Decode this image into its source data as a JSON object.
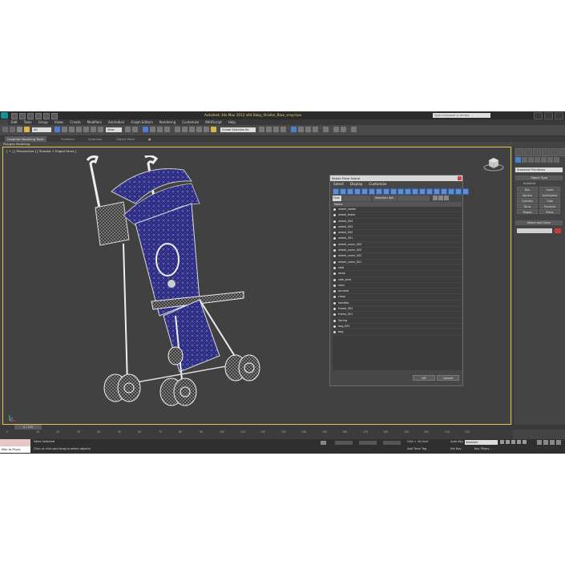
{
  "window": {
    "title": "Autodesk 3ds Max 2012 x64    Baby_Stroller_Blue_vray.max",
    "search_placeholder": "Type a keyword or phrase"
  },
  "menu": [
    "Edit",
    "Tools",
    "Group",
    "Views",
    "Create",
    "Modifiers",
    "Animation",
    "Graph Editors",
    "Rendering",
    "Customize",
    "MAXScript",
    "Help"
  ],
  "toolbar": {
    "selection_filter": "All",
    "ref_coord": "View",
    "named_selection": "Create Selection Se"
  },
  "ribbon": {
    "tabs": [
      "Graphite Modeling Tools",
      "Freeform",
      "Selection",
      "Object Paint"
    ],
    "subtitle": "Polygon Modeling"
  },
  "viewport": {
    "label": "[ + ] [ Perspective ] [ Shaded + Edged Faces ]"
  },
  "command_panel": {
    "category": "Standard Primitives",
    "object_type_header": "Object Type",
    "autogrid": "AutoGrid",
    "buttons": [
      "Box",
      "Cone",
      "Sphere",
      "GeoSphere",
      "Cylinder",
      "Tube",
      "Torus",
      "Pyramid",
      "Teapot",
      "Plane"
    ],
    "name_color_header": "Name and Color"
  },
  "dialog": {
    "title": "Select From Scene",
    "menus": [
      "Select",
      "Display",
      "Customize"
    ],
    "find_label": "Find:",
    "selection_set": "Selection Set:",
    "column_header": "Name",
    "items": [
      "wheel_holder",
      "wheel_brake",
      "wheel_004",
      "wheel_003",
      "wheel_002",
      "wheel_001",
      "wheel_cover_004",
      "wheel_cover_003",
      "wheel_cover_002",
      "wheel_cover_001",
      "seat",
      "strap",
      "side_seat",
      "rood",
      "armrest",
      "clasp",
      "handles",
      "frame_002",
      "frame_001",
      "Spring",
      "bag_001",
      "bag"
    ],
    "ok": "OK",
    "cancel": "Cancel"
  },
  "timeline": {
    "slider": "0 / 225",
    "ticks": [
      "0",
      "10",
      "20",
      "30",
      "40",
      "50",
      "60",
      "70",
      "80",
      "90",
      "100",
      "110",
      "120",
      "130",
      "140",
      "150",
      "160",
      "170",
      "180",
      "190",
      "200",
      "210",
      "220"
    ]
  },
  "status": {
    "maxscript": "Max to Physc",
    "selection": "None Selected",
    "prompt": "Click or click-and-drag to select objects",
    "grid": "Grid = 10,0cm",
    "add_time_tag": "Add Time Tag",
    "auto_key": "Auto Key",
    "set_key": "Set Key",
    "key_mode": "Selected",
    "key_filters": "Key Filters..."
  }
}
